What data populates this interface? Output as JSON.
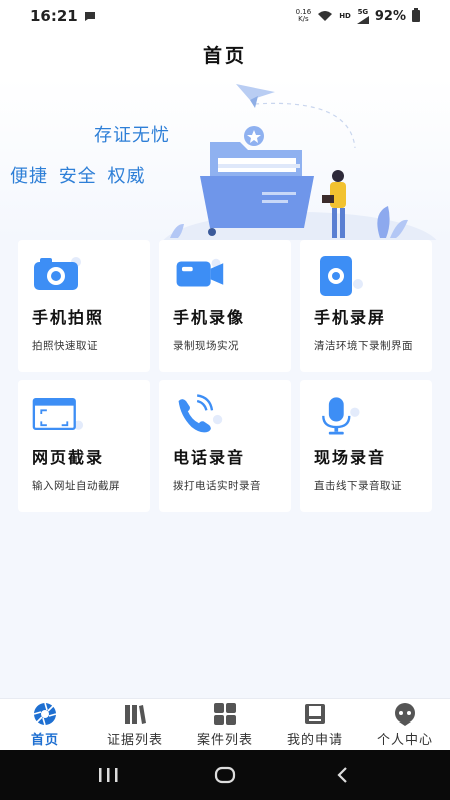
{
  "status_bar": {
    "time": "16:21",
    "net_speed_value": "0.16",
    "net_speed_unit": "K/s",
    "hd": "HD",
    "signal_gen": "5G",
    "battery": "92%"
  },
  "header": {
    "title": "首页"
  },
  "hero": {
    "slogan_line1": "存证无忧",
    "slogan_line2": "便捷 安全 权威"
  },
  "features": [
    {
      "title": "手机拍照",
      "desc": "拍照快速取证",
      "icon": "camera-icon"
    },
    {
      "title": "手机录像",
      "desc": "录制现场实况",
      "icon": "video-camera-icon"
    },
    {
      "title": "手机录屏",
      "desc": "清洁环境下录制界面",
      "icon": "screen-record-icon"
    },
    {
      "title": "网页截录",
      "desc": "输入网址自动截屏",
      "icon": "web-capture-icon"
    },
    {
      "title": "电话录音",
      "desc": "拨打电话实时录音",
      "icon": "phone-record-icon"
    },
    {
      "title": "现场录音",
      "desc": "直击线下录音取证",
      "icon": "microphone-icon"
    }
  ],
  "tabs": [
    {
      "label": "首页",
      "icon": "home-aperture-icon",
      "active": true
    },
    {
      "label": "证据列表",
      "icon": "books-icon",
      "active": false
    },
    {
      "label": "案件列表",
      "icon": "grid-icon",
      "active": false
    },
    {
      "label": "我的申请",
      "icon": "bookmark-book-icon",
      "active": false
    },
    {
      "label": "个人中心",
      "icon": "user-avatar-icon",
      "active": false
    }
  ],
  "colors": {
    "accent": "#1e6fd1",
    "slogan": "#2e7fd7",
    "background": "#f4f7fd"
  }
}
